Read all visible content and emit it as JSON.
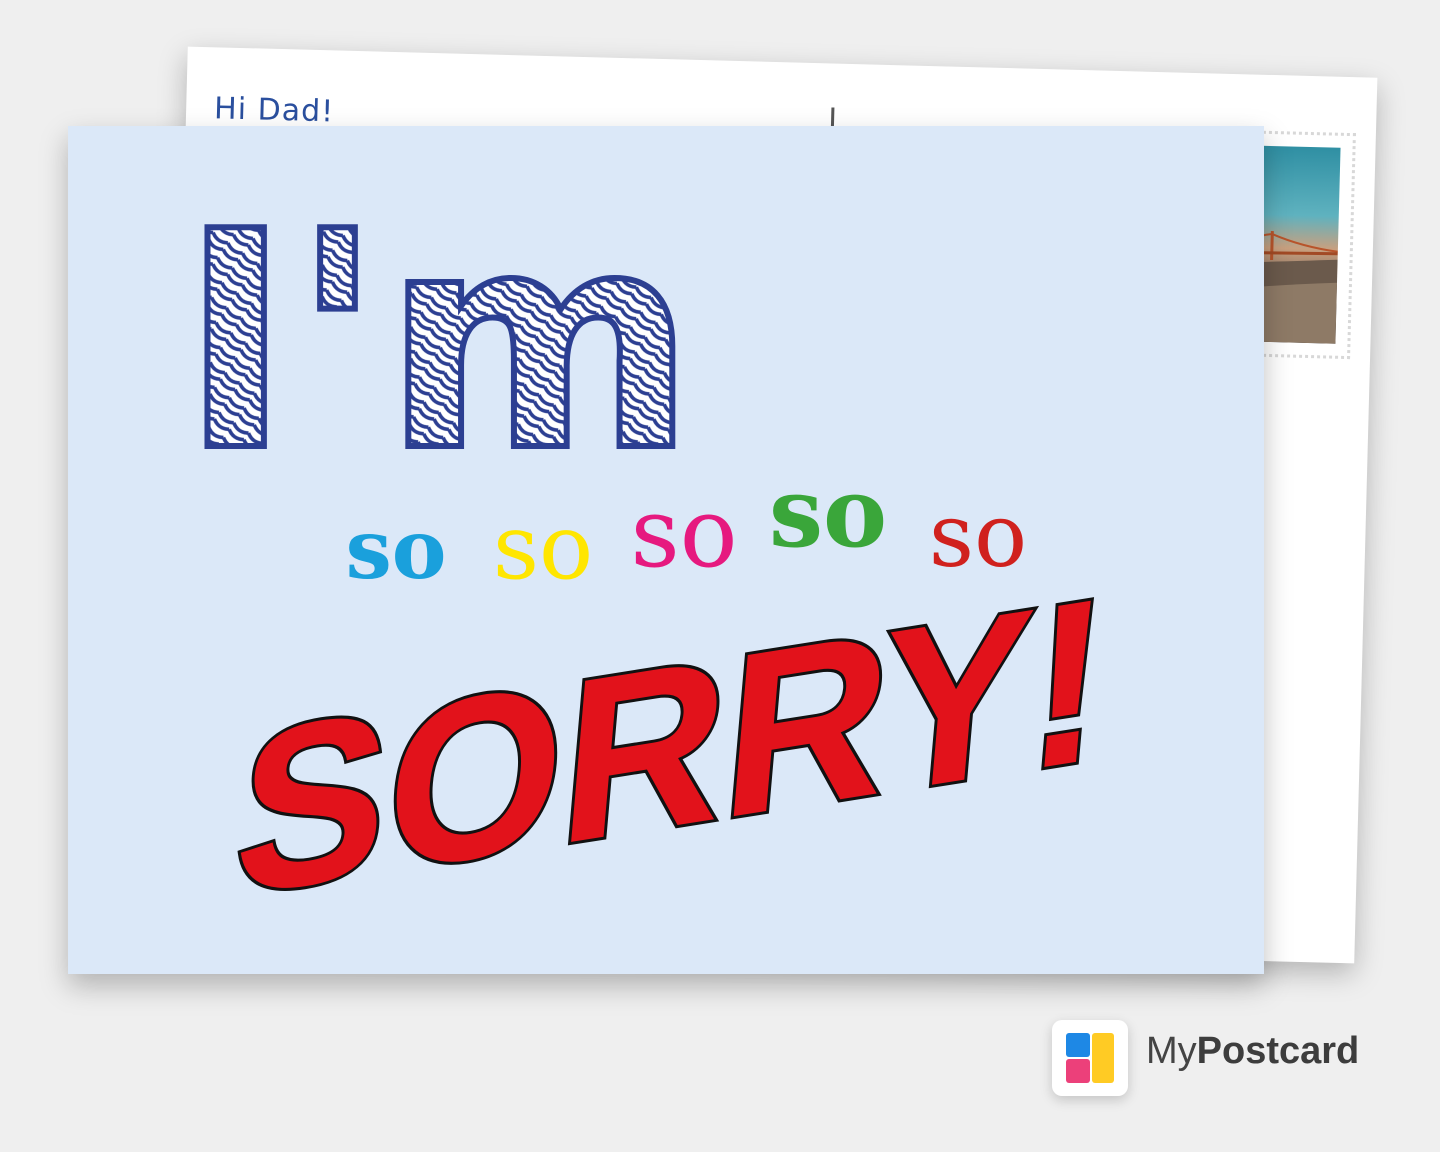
{
  "back_card": {
    "greeting": "Hi Dad!"
  },
  "front_card": {
    "line1": "I'm",
    "so_words": [
      {
        "text": "so",
        "color": "#1aa0dc"
      },
      {
        "text": "so",
        "color": "#ffe600"
      },
      {
        "text": "so",
        "color": "#e6197f"
      },
      {
        "text": "so",
        "color": "#3aa63a"
      },
      {
        "text": "so",
        "color": "#d0211e"
      }
    ],
    "line3": "SORRY!",
    "colors": {
      "im_blue": "#2c3f92",
      "sorry_red": "#e2121b",
      "card_bg": "#dbe8f8"
    }
  },
  "brand": {
    "name_light": "My",
    "name_bold": "Postcard",
    "logo_colors": [
      "#1e88e5",
      "#ffc107",
      "#ec407a",
      "#ffca28"
    ]
  }
}
